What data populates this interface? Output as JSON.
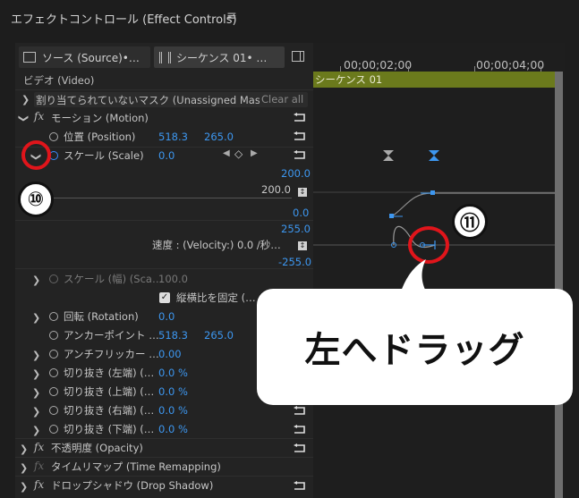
{
  "panel": {
    "title": "エフェクトコントロール (Effect Controls)",
    "menu_glyph": "≡"
  },
  "tabs": [
    {
      "label": "ソース (Source)•…"
    },
    {
      "label": "シーケンス 01• …"
    }
  ],
  "timeline": {
    "time1": "00;00;02;00",
    "time2": "00;00;04;00",
    "sequence": "シーケンス 01"
  },
  "section": {
    "video": "ビデオ (Video)",
    "mask": "割り当てられていないマスク (Unassigned Masks)",
    "clear": "Clear all"
  },
  "motion": {
    "label": "モーション (Motion)",
    "position": {
      "label": "位置 (Position)",
      "x": "518.3",
      "y": "265.0"
    },
    "scale": {
      "label": "スケール (Scale)",
      "value": "0.0"
    },
    "graph": {
      "max": "200.0",
      "mid": "200.0",
      "min": "0.0",
      "vmax": "255.0",
      "velocity": "速度 : (Velocity:) 0.0 /秒…",
      "vmin": "-255.0"
    },
    "scale_width": {
      "label": "スケール (幅) (Sca…",
      "value": "100.0"
    },
    "uniform": {
      "label": "縦横比を固定 (…"
    },
    "rotation": {
      "label": "回転 (Rotation)",
      "value": "0.0"
    },
    "anchor": {
      "label": "アンカーポイント …",
      "x": "518.3",
      "y": "265.0"
    },
    "antiflicker": {
      "label": "アンチフリッカー …",
      "value": "0.00"
    },
    "crops": [
      {
        "label": "切り抜き (左端) (…",
        "value": "0.0 %"
      },
      {
        "label": "切り抜き (上端) (…",
        "value": "0.0 %"
      },
      {
        "label": "切り抜き (右端) (…",
        "value": "0.0 %"
      },
      {
        "label": "切り抜き (下端) (…",
        "value": "0.0 %"
      }
    ]
  },
  "effects": [
    {
      "label": "不透明度 (Opacity)"
    },
    {
      "label": "タイムリマップ (Time Remapping)"
    },
    {
      "label": "ドロップシャドウ (Drop Shadow)"
    }
  ],
  "annotations": {
    "badge10": "⑩",
    "badge11": "⑪",
    "callout": "左へドラッグ"
  },
  "colors": {
    "accent": "#3d97f0",
    "sequence_bar": "#6b7a1c",
    "highlight_ring": "#e0151b"
  }
}
